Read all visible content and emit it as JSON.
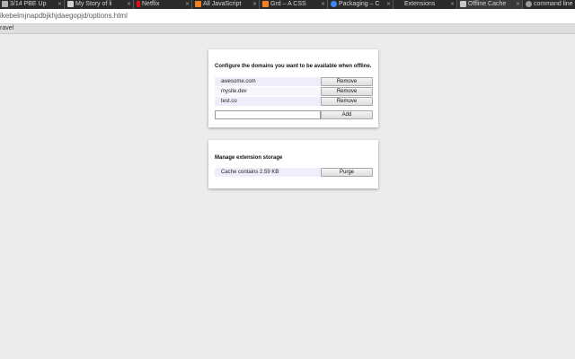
{
  "tabs": [
    {
      "label": "3/14 PBE Up",
      "favicon_color": "#b0b0b0"
    },
    {
      "label": "My Story of li",
      "favicon_color": "#cfcfcf"
    },
    {
      "label": "Netflix",
      "favicon_color": "#e50914"
    },
    {
      "label": "All JavaScript",
      "favicon_color": "#f48024"
    },
    {
      "label": "Grd – A CSS",
      "favicon_color": "#f48024"
    },
    {
      "label": "Packaging – C",
      "favicon_color": "#4285f4"
    },
    {
      "label": "Extensions",
      "favicon_color": "#2b2b2b"
    },
    {
      "label": "Offline Cache",
      "favicon_color": "#c8c8c8"
    },
    {
      "label": "command line",
      "favicon_color": "#9a9a9a"
    }
  ],
  "address_bar": {
    "url": "ikebelmjnapdbjkhjdaegopjd/options.html"
  },
  "bookmarks": {
    "item": "ravel"
  },
  "domains_card": {
    "title": "Configure the domains you want to be available when offline.",
    "domains": [
      "awesome.com",
      "mysite.dev",
      "test.co"
    ],
    "remove_label": "Remove",
    "add_input_value": "",
    "add_label": "Add"
  },
  "storage_card": {
    "title": "Manage extension storage",
    "cache_text": "Cache contains 2.59 KB",
    "purge_label": "Purge"
  }
}
